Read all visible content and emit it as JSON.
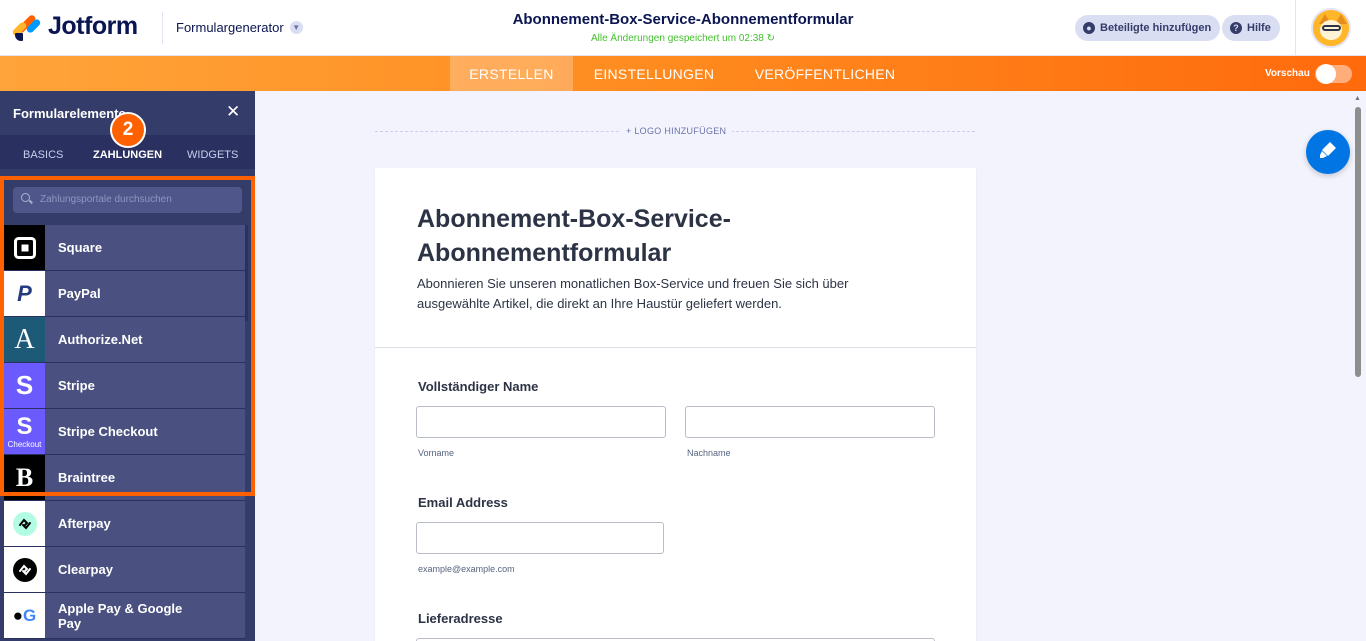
{
  "header": {
    "brand": "Jotform",
    "form_generator": "Formulargenerator",
    "form_title": "Abonnement-Box-Service-Abonnementformular",
    "saved_status": "Alle Änderungen gespeichert um 02:38 ↻",
    "add_participants": "Beteiligte hinzufügen",
    "help": "Hilfe"
  },
  "nav": {
    "tabs": [
      {
        "label": "ERSTELLEN",
        "active": true
      },
      {
        "label": "EINSTELLUNGEN",
        "active": false
      },
      {
        "label": "VERÖFFENTLICHEN",
        "active": false
      }
    ],
    "preview_label": "Vorschau"
  },
  "sidebar": {
    "title": "Formularelemente",
    "tabs": [
      {
        "label": "BASICS",
        "active": false
      },
      {
        "label": "ZAHLUNGEN",
        "active": true
      },
      {
        "label": "WIDGETS",
        "active": false
      }
    ],
    "step_badge": "2",
    "search_placeholder": "Zahlungsportale durchsuchen",
    "items": [
      {
        "label": "Square",
        "icon": "square-icon"
      },
      {
        "label": "PayPal",
        "icon": "paypal-icon"
      },
      {
        "label": "Authorize.Net",
        "icon": "authorize-net-icon"
      },
      {
        "label": "Stripe",
        "icon": "stripe-icon"
      },
      {
        "label": "Stripe Checkout",
        "icon": "stripe-checkout-icon",
        "icon_caption": "Checkout"
      },
      {
        "label": "Braintree",
        "icon": "braintree-icon"
      },
      {
        "label": "Afterpay",
        "icon": "afterpay-icon"
      },
      {
        "label": "Clearpay",
        "icon": "clearpay-icon"
      },
      {
        "label": "Apple Pay & Google Pay",
        "icon": "apple-google-pay-icon"
      }
    ]
  },
  "form": {
    "add_logo": "+ LOGO HINZUFÜGEN",
    "title": "Abonnement-Box-Service-Abonnementformular",
    "description": "Abonnieren Sie unseren monatlichen Box-Service und freuen Sie sich über ausgewählte Artikel, die direkt an Ihre Haustür geliefert werden.",
    "full_name_label": "Vollständiger Name",
    "first_name_sub": "Vorname",
    "last_name_sub": "Nachname",
    "email_label": "Email Address",
    "email_sub": "example@example.com",
    "address_label": "Lieferadresse"
  },
  "colors": {
    "brand_navy": "#0a1551",
    "orange": "#ff6100",
    "sidebar": "#343c6a",
    "fab_blue": "#0075e3"
  }
}
